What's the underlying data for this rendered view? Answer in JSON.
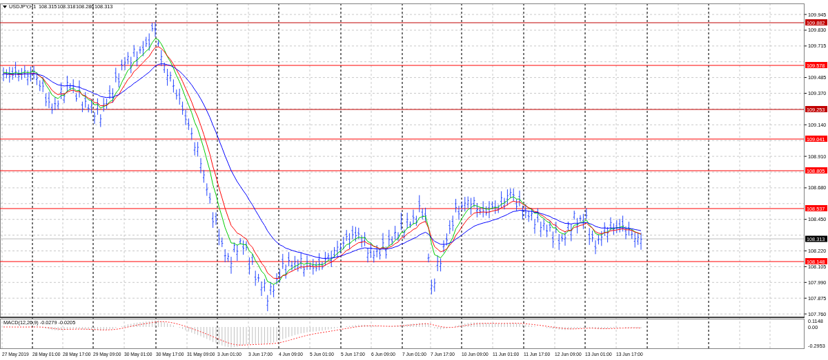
{
  "header": {
    "symbol": "USDJPY,H1",
    "quotes": [
      "108.315",
      "108.318",
      "108.286",
      "108.313"
    ]
  },
  "price_axis": {
    "ticks": [
      "109.945",
      "109.830",
      "109.715",
      "109.485",
      "109.370",
      "109.140",
      "108.910",
      "108.680",
      "108.450",
      "108.220",
      "108.105",
      "107.990",
      "107.875",
      "107.760"
    ],
    "levels": [
      {
        "label": "109.882",
        "color": "#c00000"
      },
      {
        "label": "109.578",
        "color": "#ff0000"
      },
      {
        "label": "109.253",
        "color": "#c00000"
      },
      {
        "label": "109.041",
        "color": "#ff0000"
      },
      {
        "label": "108.805",
        "color": "#ff0000"
      },
      {
        "label": "108.537",
        "color": "#ff0000"
      },
      {
        "label": "108.148",
        "color": "#ff0000"
      }
    ],
    "current_price": "108.313"
  },
  "macd": {
    "label": "MACD(12,26,9) -0.0279 -0.0205",
    "ticks": [
      "0.1148",
      "0.00",
      "-0.2953"
    ]
  },
  "time_axis": [
    "27 May 2019",
    "28 May 01:00",
    "28 May 17:00",
    "29 May 09:00",
    "30 May 01:00",
    "30 May 17:00",
    "31 May 09:00",
    "3 Jun 01:00",
    "3 Jun 17:00",
    "4 Jun 09:00",
    "5 Jun 01:00",
    "5 Jun 17:00",
    "6 Jun 09:00",
    "7 Jun 01:00",
    "7 Jun 17:00",
    "10 Jun 09:00",
    "11 Jun 01:00",
    "11 Jun 17:00",
    "12 Jun 09:00",
    "13 Jun 01:00",
    "13 Jun 17:00"
  ]
}
